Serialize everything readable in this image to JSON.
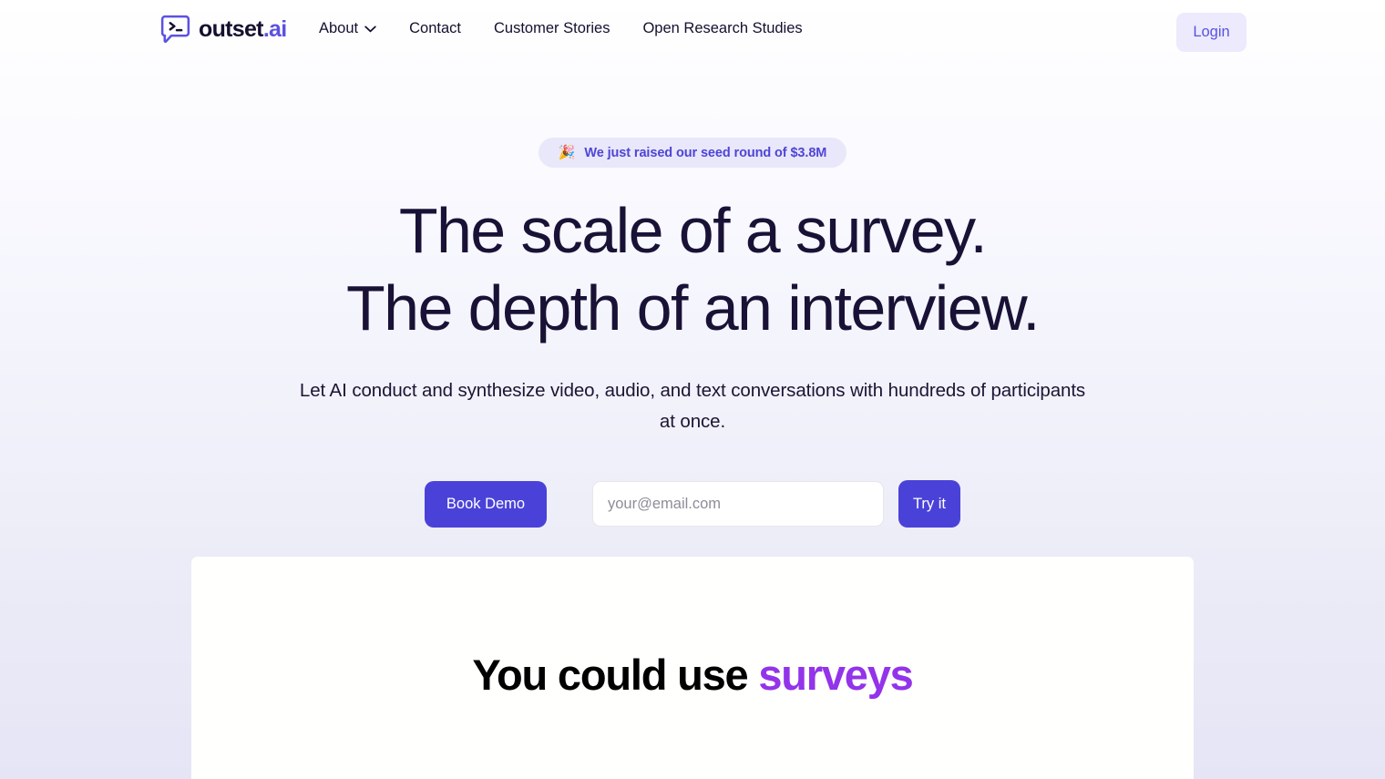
{
  "header": {
    "logo": {
      "icon": "terminal-speech-bubble-icon",
      "wordmark_dark": "outset",
      "wordmark_accent": ".ai"
    },
    "nav": [
      {
        "label": "About",
        "has_dropdown": true,
        "icon": "chevron-down-icon"
      },
      {
        "label": "Contact",
        "has_dropdown": false
      },
      {
        "label": "Customer Stories",
        "has_dropdown": false
      },
      {
        "label": "Open Research Studies",
        "has_dropdown": false
      }
    ],
    "login_label": "Login"
  },
  "hero": {
    "announcement": {
      "emoji": "🎉",
      "text": "We just raised our seed round of $3.8M"
    },
    "headline_line1": "The scale of a survey.",
    "headline_line2": "The depth of an interview.",
    "subtitle": "Let AI conduct and synthesize video, audio, and text conversations with hundreds of participants at once.",
    "book_demo_label": "Book Demo",
    "email_placeholder": "your@email.com",
    "email_value": "",
    "try_it_label": "Try it"
  },
  "panel": {
    "heading_plain": "You could use ",
    "heading_accent": "surveys"
  },
  "colors": {
    "brand_indigo": "#4a42d8",
    "brand_accent_light": "#5b52e0",
    "login_bg": "#eceafc",
    "pill_bg": "#e9e7fa",
    "pill_text": "#4e45d6",
    "headline": "#191236",
    "panel_accent_purple": "#9333ea",
    "page_bg_top": "#ffffff",
    "page_bg_bottom": "#e5e5f6",
    "panel_bg": "#fffffd"
  }
}
